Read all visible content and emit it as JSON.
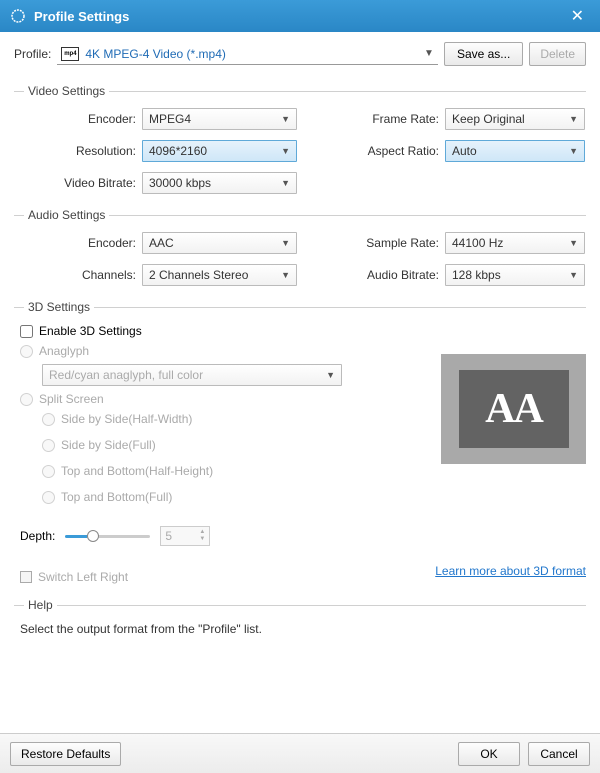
{
  "titlebar": {
    "title": "Profile Settings"
  },
  "profile": {
    "label": "Profile:",
    "value": "4K MPEG-4 Video (*.mp4)",
    "save_as": "Save as...",
    "delete": "Delete"
  },
  "video": {
    "section": "Video Settings",
    "encoder_label": "Encoder:",
    "encoder": "MPEG4",
    "resolution_label": "Resolution:",
    "resolution": "4096*2160",
    "bitrate_label": "Video Bitrate:",
    "bitrate": "30000 kbps",
    "framerate_label": "Frame Rate:",
    "framerate": "Keep Original",
    "aspect_label": "Aspect Ratio:",
    "aspect": "Auto"
  },
  "audio": {
    "section": "Audio Settings",
    "encoder_label": "Encoder:",
    "encoder": "AAC",
    "channels_label": "Channels:",
    "channels": "2 Channels Stereo",
    "samplerate_label": "Sample Rate:",
    "samplerate": "44100 Hz",
    "bitrate_label": "Audio Bitrate:",
    "bitrate": "128 kbps"
  },
  "d3": {
    "section": "3D Settings",
    "enable": "Enable 3D Settings",
    "anaglyph": "Anaglyph",
    "anaglyph_value": "Red/cyan anaglyph, full color",
    "split": "Split Screen",
    "sbs_half": "Side by Side(Half-Width)",
    "sbs_full": "Side by Side(Full)",
    "tb_half": "Top and Bottom(Half-Height)",
    "tb_full": "Top and Bottom(Full)",
    "depth_label": "Depth:",
    "depth_value": "5",
    "switch": "Switch Left Right",
    "learn": "Learn more about 3D format",
    "preview_text": "AA"
  },
  "help": {
    "section": "Help",
    "text": "Select the output format from the \"Profile\" list."
  },
  "footer": {
    "restore": "Restore Defaults",
    "ok": "OK",
    "cancel": "Cancel"
  }
}
